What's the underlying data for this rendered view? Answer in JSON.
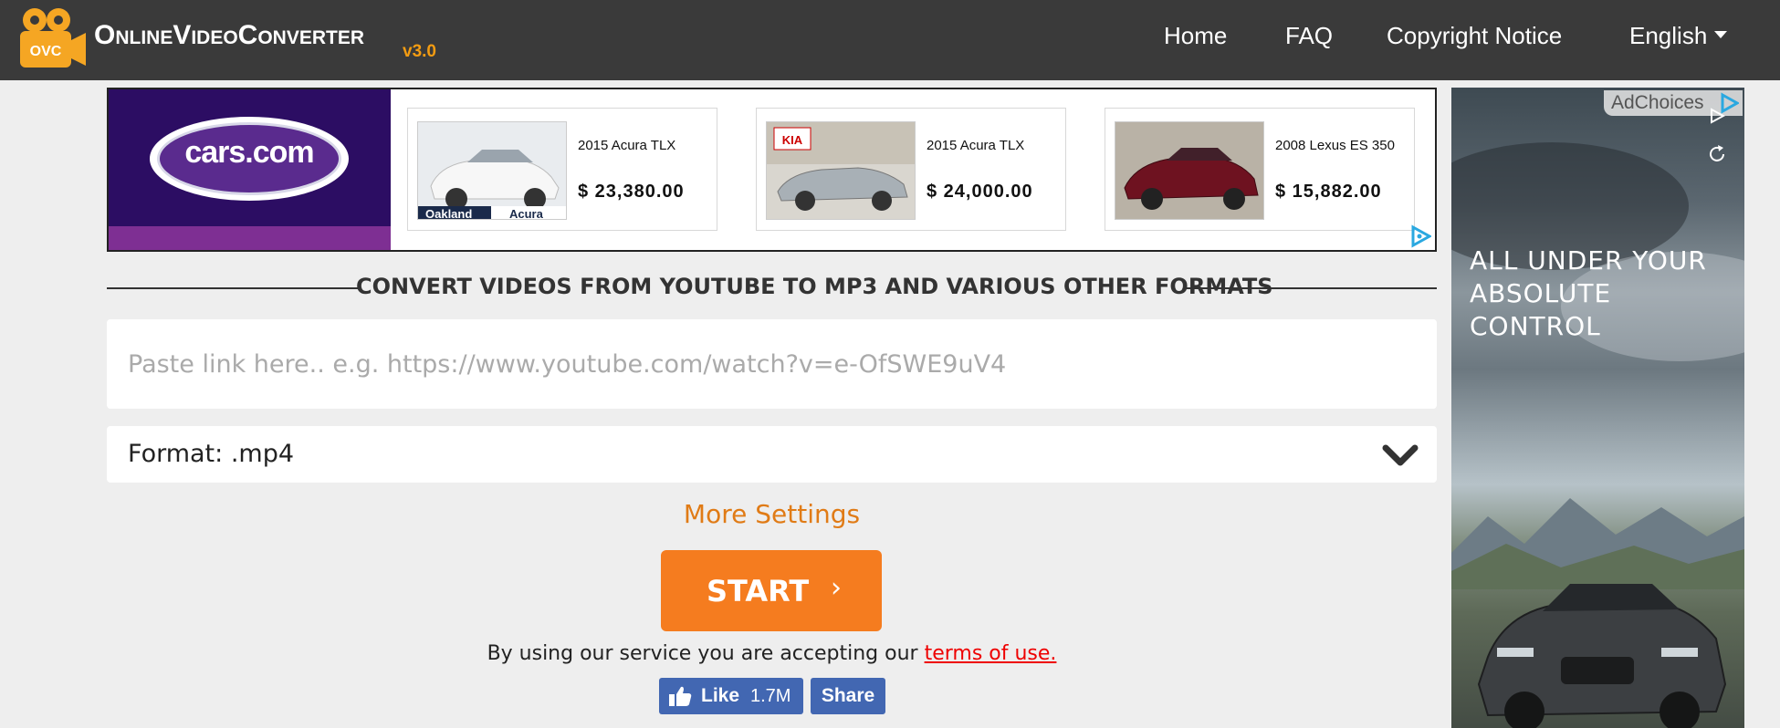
{
  "navbar": {
    "logo_text": "OVC",
    "brand": "OnlineVideoConverter",
    "version": "v3.0",
    "links": [
      "Home",
      "FAQ",
      "Copyright Notice"
    ],
    "language": "English"
  },
  "banner_ad": {
    "brand": "cars.com",
    "cars": [
      {
        "title": "2015 Acura TLX",
        "price": "$ 23,380.00",
        "img_caption_left": "Oakland",
        "img_caption_right": "Acura"
      },
      {
        "title": "2015 Acura TLX",
        "price": "$ 24,000.00",
        "img_caption_left": "KIA",
        "img_caption_right": ""
      },
      {
        "title": "2008 Lexus ES 350",
        "price": "$ 15,882.00",
        "img_caption_left": "",
        "img_caption_right": ""
      }
    ],
    "adchoices_icon": "adchoices-triangle-icon"
  },
  "main": {
    "section_title": "CONVERT VIDEOS FROM YOUTUBE TO MP3 AND VARIOUS OTHER FORMATS",
    "url_input": {
      "value": "",
      "placeholder": "Paste link here.. e.g. https://www.youtube.com/watch?v=e-OfSWE9uV4"
    },
    "format_label": "Format: .mp4",
    "more_settings": "More Settings",
    "start_label": "START",
    "start_chevron": "›",
    "terms_prefix": "By using our service you are accepting our",
    "terms_link": "terms of use.",
    "fb_like_label": "Like",
    "fb_like_count": "1.7M",
    "fb_share_label": "Share"
  },
  "side_ad": {
    "adchoices_label": "AdChoices",
    "headline_line1": "ALL UNDER YOUR",
    "headline_line2": "ABSOLUTE CONTROL"
  },
  "colors": {
    "navbar_bg": "#3a3a3a",
    "accent_orange": "#f57c1f",
    "version_orange": "#f39c12",
    "link_red": "#ee0000",
    "facebook_blue": "#4267b2",
    "cars_purple": "#2c0d63"
  }
}
